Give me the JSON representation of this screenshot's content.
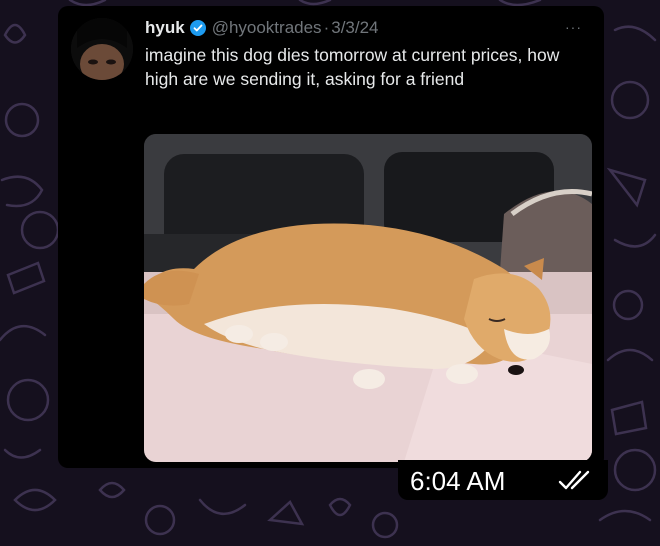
{
  "tweet": {
    "display_name": "hyuk",
    "handle": "@hyooktrades",
    "separator": "·",
    "date": "3/3/24",
    "text": "imagine this dog dies tomorrow at current prices, how high are we sending it, asking for a friend",
    "media_icon": "sleeping-shiba-dog-photo"
  },
  "message": {
    "time": "6:04 AM",
    "status_icon": "double-check-icon"
  },
  "colors": {
    "wallpaper": "#15101e",
    "card": "#000000",
    "verified": "#1d9bf0",
    "text": "#e7e9ea",
    "muted": "#71767b"
  }
}
